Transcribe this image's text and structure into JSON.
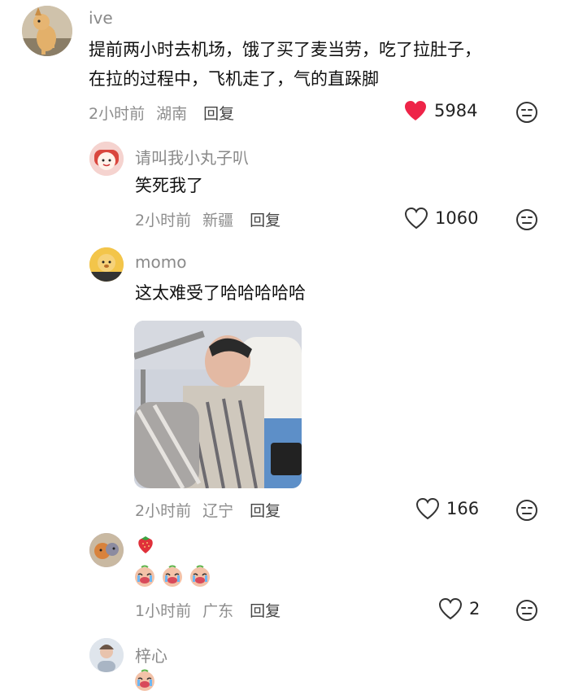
{
  "comments": [
    {
      "username": "ive",
      "text_line1": "提前两小时去机场，饿了买了麦当劳，吃了拉肚子，",
      "text_line2": "在拉的过程中，飞机走了，气的直跺脚",
      "time": "2小时前",
      "location": "湖南",
      "reply": "回复",
      "likes": "5984",
      "liked": true
    },
    {
      "username": "请叫我小丸子叭",
      "text": "笑死我了",
      "time": "2小时前",
      "location": "新疆",
      "reply": "回复",
      "likes": "1060",
      "liked": false
    },
    {
      "username": "momo",
      "text": "这太难受了哈哈哈哈哈",
      "time": "2小时前",
      "location": "辽宁",
      "reply": "回复",
      "likes": "166",
      "liked": false
    },
    {
      "username": "",
      "time": "1小时前",
      "location": "广东",
      "reply": "回复",
      "likes": "2",
      "liked": false
    },
    {
      "username": "梓心"
    }
  ],
  "colors": {
    "heart_liked": "#ee2448",
    "meta_gray": "#8d8d8d",
    "name_gray": "#8a8a8a"
  }
}
